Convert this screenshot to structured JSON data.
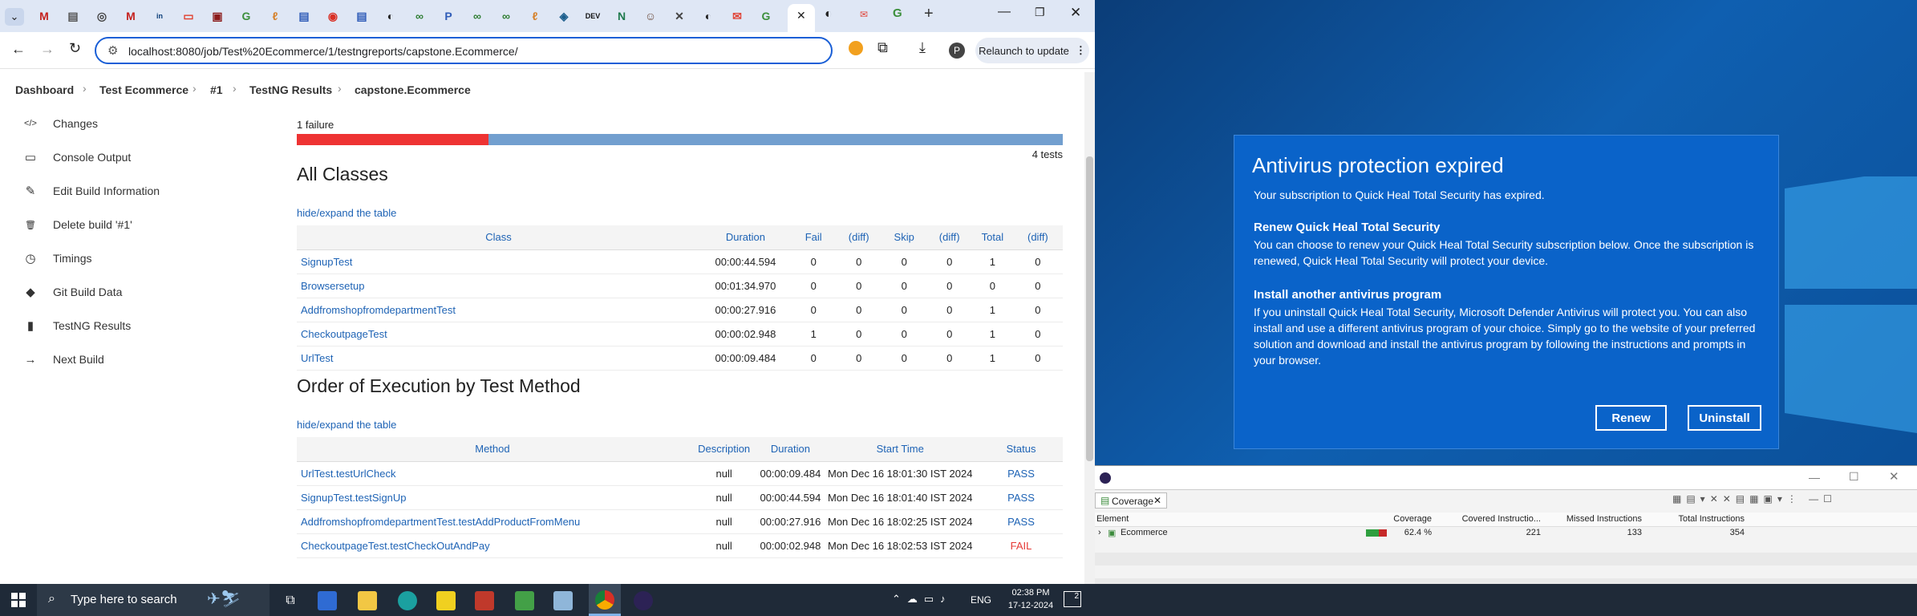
{
  "browser": {
    "url": "localhost:8080/job/Test%20Ecommerce/1/testngreports/capstone.Ecommerce/",
    "relaunch": "Relaunch to update",
    "profile": "P",
    "tabs": [
      {
        "icon": "gmail-icon",
        "color": "#c5221f",
        "glyph": "M"
      },
      {
        "icon": "docs-icon",
        "color": "#555",
        "glyph": "▤"
      },
      {
        "icon": "circle-icon",
        "color": "#444",
        "glyph": "◎"
      },
      {
        "icon": "gmail-icon",
        "color": "#c5221f",
        "glyph": "M"
      },
      {
        "icon": "linkedin-icon",
        "color": "#0a3d78",
        "glyph": "in"
      },
      {
        "icon": "youtube-icon",
        "color": "#e03e2d",
        "glyph": "▭"
      },
      {
        "icon": "app-icon",
        "color": "#8b1a1a",
        "glyph": "▣"
      },
      {
        "icon": "google-icon",
        "color": "#3c8f3c",
        "glyph": "G"
      },
      {
        "icon": "flame-icon",
        "color": "#d6822b",
        "glyph": "ℓ"
      },
      {
        "icon": "docs-icon",
        "color": "#2f5cb8",
        "glyph": "▤"
      },
      {
        "icon": "app-icon",
        "color": "#d93025",
        "glyph": "◉"
      },
      {
        "icon": "docs-icon",
        "color": "#2f5cb8",
        "glyph": "▤"
      },
      {
        "icon": "github-icon",
        "color": "#222",
        "glyph": "◐"
      },
      {
        "icon": "app-icon",
        "color": "#2e7d32",
        "glyph": "∞"
      },
      {
        "icon": "app-icon",
        "color": "#2f5cb8",
        "glyph": "P"
      },
      {
        "icon": "app-icon",
        "color": "#2e7d32",
        "glyph": "∞"
      },
      {
        "icon": "app-icon",
        "color": "#2e7d32",
        "glyph": "∞"
      },
      {
        "icon": "flame-icon",
        "color": "#d6822b",
        "glyph": "ℓ"
      },
      {
        "icon": "app-icon",
        "color": "#1a5d8c",
        "glyph": "◈"
      },
      {
        "icon": "dev-icon",
        "color": "#111",
        "glyph": "DEV"
      },
      {
        "icon": "app-icon",
        "color": "#1f7a4d",
        "glyph": "N"
      },
      {
        "icon": "avatar-icon",
        "color": "#6b4a3a",
        "glyph": "☺"
      },
      {
        "icon": "jenkins-icon",
        "color": "#444",
        "glyph": "✕"
      },
      {
        "icon": "github-icon",
        "color": "#222",
        "glyph": "◐"
      },
      {
        "icon": "app-icon",
        "color": "#e0463a",
        "glyph": "✉"
      },
      {
        "icon": "google-icon",
        "color": "#3c8f3c",
        "glyph": "G"
      }
    ]
  },
  "breadcrumb": [
    "Dashboard",
    "Test Ecommerce",
    "#1",
    "TestNG Results",
    "capstone.Ecommerce"
  ],
  "sidebar": [
    {
      "label": "Changes",
      "icon": "code-icon",
      "glyph": "</>"
    },
    {
      "label": "Console Output",
      "icon": "terminal-icon",
      "glyph": "▭"
    },
    {
      "label": "Edit Build Information",
      "icon": "edit-icon",
      "glyph": "✎"
    },
    {
      "label": "Delete build '#1'",
      "icon": "trash-icon",
      "glyph": "🗑"
    },
    {
      "label": "Timings",
      "icon": "clock-icon",
      "glyph": "◷"
    },
    {
      "label": "Git Build Data",
      "icon": "git-icon",
      "glyph": "◆"
    },
    {
      "label": "TestNG Results",
      "icon": "chart-icon",
      "glyph": "▮"
    },
    {
      "label": "Next Build",
      "icon": "arrow-right-icon",
      "glyph": "→"
    }
  ],
  "summary": {
    "failures": "1 failure",
    "tests": "4 tests",
    "fail_fraction": 0.25,
    "fail_color": "#ee3333",
    "pass_color": "#729fcf"
  },
  "classes": {
    "title": "All Classes",
    "toggle": "hide/expand the table",
    "headers": [
      "Class",
      "Duration",
      "Fail",
      "(diff)",
      "Skip",
      "(diff)",
      "Total",
      "(diff)"
    ],
    "rows": [
      [
        "SignupTest",
        "00:00:44.594",
        "0",
        "0",
        "0",
        "0",
        "1",
        "0"
      ],
      [
        "Browsersetup",
        "00:01:34.970",
        "0",
        "0",
        "0",
        "0",
        "0",
        "0"
      ],
      [
        "AddfromshopfromdepartmentTest",
        "00:00:27.916",
        "0",
        "0",
        "0",
        "0",
        "1",
        "0"
      ],
      [
        "CheckoutpageTest",
        "00:00:02.948",
        "1",
        "0",
        "0",
        "0",
        "1",
        "0"
      ],
      [
        "UrlTest",
        "00:00:09.484",
        "0",
        "0",
        "0",
        "0",
        "1",
        "0"
      ]
    ]
  },
  "methods": {
    "title": "Order of Execution by Test Method",
    "toggle": "hide/expand the table",
    "headers": [
      "Method",
      "Description",
      "Duration",
      "Start Time",
      "Status"
    ],
    "rows": [
      [
        "UrlTest.testUrlCheck",
        "null",
        "00:00:09.484",
        "Mon Dec 16 18:01:30 IST 2024",
        "PASS"
      ],
      [
        "SignupTest.testSignUp",
        "null",
        "00:00:44.594",
        "Mon Dec 16 18:01:40 IST 2024",
        "PASS"
      ],
      [
        "AddfromshopfromdepartmentTest.testAddProductFromMenu",
        "null",
        "00:00:27.916",
        "Mon Dec 16 18:02:25 IST 2024",
        "PASS"
      ],
      [
        "CheckoutpageTest.testCheckOutAndPay",
        "null",
        "00:00:02.948",
        "Mon Dec 16 18:02:53 IST 2024",
        "FAIL"
      ]
    ]
  },
  "dialog": {
    "title": "Antivirus protection expired",
    "line1": "Your subscription to Quick Heal Total Security has expired.",
    "h2": "Renew Quick Heal Total Security",
    "p2": "You can choose to renew your Quick Heal Total Security subscription below. Once the subscription is renewed, Quick Heal Total Security will protect your device.",
    "h3": "Install another antivirus program",
    "p3": "If you uninstall Quick Heal Total Security, Microsoft Defender Antivirus will protect you. You can also install and use a different antivirus program of your choice. Simply go to the website of your preferred solution and download and install the antivirus program by following the instructions and prompts in your browser.",
    "renew": "Renew",
    "uninstall": "Uninstall"
  },
  "coverage": {
    "tab": "Coverage",
    "headers": [
      "Element",
      "Coverage",
      "Covered Instructio...",
      "Missed Instructions",
      "Total Instructions"
    ],
    "row": [
      "Ecommerce",
      "62.4 %",
      "221",
      "133",
      "354"
    ],
    "covered_fraction": 0.624
  },
  "taskbar": {
    "search": "Type here to search",
    "lang": "ENG",
    "time": "02:38 PM",
    "date": "17-12-2024",
    "notifications": "2"
  }
}
